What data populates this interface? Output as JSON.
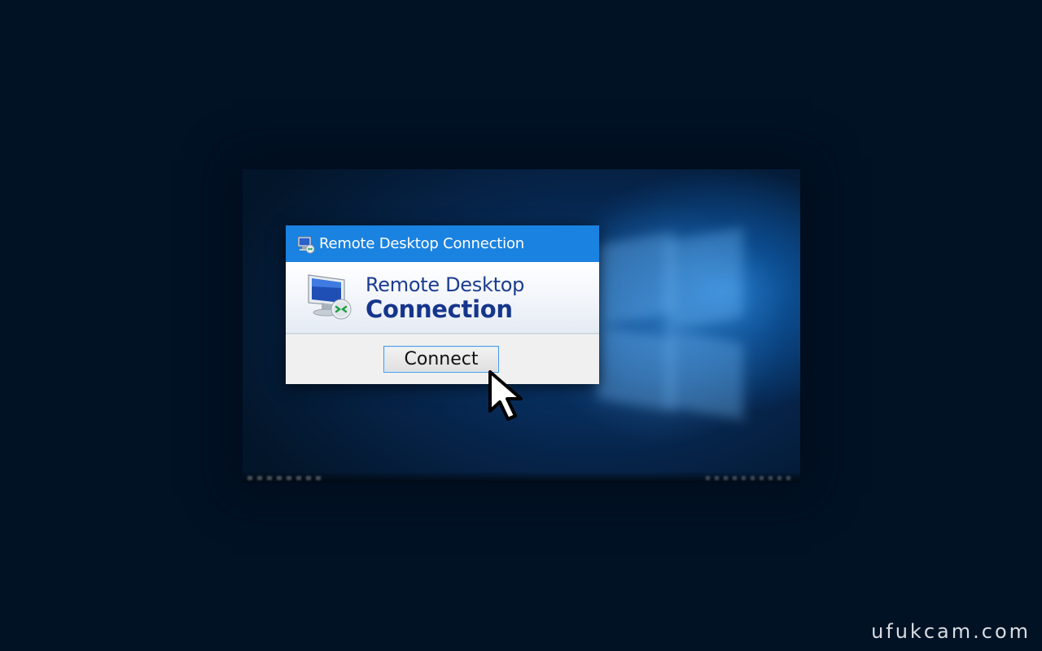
{
  "dialog": {
    "title": "Remote Desktop Connection",
    "title_icon": "remote-desktop-icon",
    "banner": {
      "line1": "Remote Desktop",
      "line2": "Connection",
      "icon": "remote-desktop-monitor-icon"
    },
    "connect_label": "Connect"
  },
  "cursor": {
    "icon": "mouse-pointer-icon"
  },
  "watermark": "ufukcam.com",
  "colors": {
    "page_background": "#001224",
    "title_bar": "#1a82e0",
    "banner_text": "#1b3c8f",
    "button_border": "#4a9ae3"
  }
}
